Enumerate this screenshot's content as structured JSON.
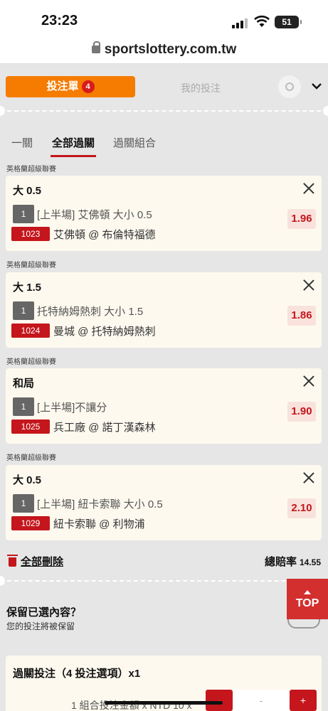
{
  "status_bar": {
    "time": "23:23",
    "battery": "51"
  },
  "browser": {
    "url": "sportslottery.com.tw"
  },
  "slip_tabs": {
    "bet_slip": "投注單",
    "bet_slip_count": "4",
    "my_bets": "我的投注"
  },
  "parlay_tabs": [
    {
      "label": "一關"
    },
    {
      "label": "全部過關"
    },
    {
      "label": "過關組合"
    }
  ],
  "bets": [
    {
      "league": "英格蘭超級聯賽",
      "selection": "大 0.5",
      "num": "1",
      "market": "[上半場] 艾佛頓 大小 0.5",
      "code": "1023",
      "match": "艾佛頓 @ 布倫特福德",
      "odds": "1.96"
    },
    {
      "league": "英格蘭超級聯賽",
      "selection": "大 1.5",
      "num": "1",
      "market": "托特納姆熱刺 大小 1.5",
      "code": "1024",
      "match": "曼城 @ 托特納姆熱刺",
      "odds": "1.86"
    },
    {
      "league": "英格蘭超級聯賽",
      "selection": "和局",
      "num": "1",
      "market": "[上半場]不讓分",
      "code": "1025",
      "match": "兵工廠 @ 諾丁漢森林",
      "odds": "1.90"
    },
    {
      "league": "英格蘭超級聯賽",
      "selection": "大 0.5",
      "num": "1",
      "market": "[上半場] 紐卡索聯 大小 0.5",
      "code": "1029",
      "match": "紐卡索聯 @ 利物浦",
      "odds": "2.10"
    }
  ],
  "footer": {
    "delete_all": "全部刪除",
    "total_odds_label": "總賠率",
    "total_odds_value": "14.55"
  },
  "keep_selection": {
    "title": "保留已選內容？",
    "subtitle": "您的投注將被保留"
  },
  "top_button": "TOP",
  "parlay_bet": {
    "title": "過關投注（4 投注選項）x1",
    "amount_text": "1 組合投注金額 x NTD 10 x",
    "minus": "-",
    "value": "-",
    "plus": "+"
  },
  "colors": {
    "accent_orange": "#f57c00",
    "accent_red": "#c4161c",
    "card_bg": "#fdf9ef"
  },
  "icons": [
    "lock-icon",
    "gear-icon",
    "chevron-down-icon",
    "close-icon",
    "trash-icon",
    "arrow-up-icon"
  ]
}
